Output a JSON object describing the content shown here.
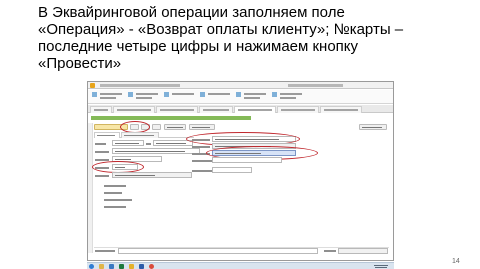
{
  "slide": {
    "lines": [
      "В Эквайринговой операции заполняем поле",
      "«Операция» - «Возврат оплаты клиенту»; №карты –",
      "последние четыре цифры и нажимаем кнопку",
      "«Провести»"
    ],
    "page_number": "14"
  },
  "screenshot": {
    "window_title": "",
    "document_title": "",
    "operation_field_value": "",
    "operation_dropdown_option": "",
    "card_number_value": "",
    "post_button_label": "",
    "accent_colors": {
      "annotation_oval": "#c0272d",
      "primary_button": "#f7e6a7",
      "document_title": "#6fae3b",
      "selected_option": "#d7e3f7"
    }
  },
  "taskbar": {
    "icons": [
      "start-icon",
      "explorer-icon",
      "browser-icon",
      "excel-icon",
      "1c-icon",
      "word-icon",
      "chrome-icon"
    ],
    "clock": ""
  }
}
